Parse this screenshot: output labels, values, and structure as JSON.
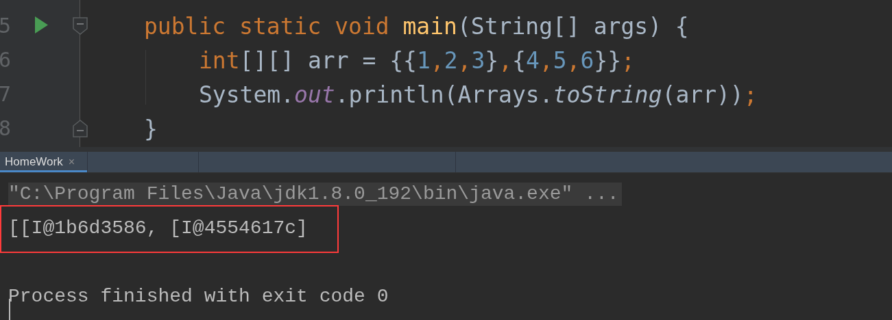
{
  "editor": {
    "lines": [
      {
        "number": "5",
        "runnable": true,
        "fold_start": true,
        "tokens": [
          {
            "text": "public static void ",
            "kind": "keyword"
          },
          {
            "text": "main",
            "kind": "method"
          },
          {
            "text": "(String[] args) {",
            "kind": "plain"
          }
        ],
        "children": [
          {
            "number": "6",
            "tokens": [
              {
                "text": "int",
                "kind": "keyword"
              },
              {
                "text": "[][] arr = {{",
                "kind": "plain"
              },
              {
                "text": "1",
                "kind": "number"
              },
              {
                "text": ",",
                "kind": "keyword"
              },
              {
                "text": "2",
                "kind": "number"
              },
              {
                "text": ",",
                "kind": "keyword"
              },
              {
                "text": "3",
                "kind": "number"
              },
              {
                "text": "}",
                "kind": "plain"
              },
              {
                "text": ",",
                "kind": "keyword"
              },
              {
                "text": "{",
                "kind": "plain"
              },
              {
                "text": "4",
                "kind": "number"
              },
              {
                "text": ",",
                "kind": "keyword"
              },
              {
                "text": "5",
                "kind": "number"
              },
              {
                "text": ",",
                "kind": "keyword"
              },
              {
                "text": "6",
                "kind": "number"
              },
              {
                "text": "}}",
                "kind": "plain"
              },
              {
                "text": ";",
                "kind": "keyword"
              }
            ]
          },
          {
            "number": "7",
            "tokens": [
              {
                "text": "System.",
                "kind": "plain"
              },
              {
                "text": "out",
                "kind": "field"
              },
              {
                "text": ".println(Arrays.",
                "kind": "plain"
              },
              {
                "text": "toString",
                "kind": "static"
              },
              {
                "text": "(arr))",
                "kind": "plain"
              },
              {
                "text": ";",
                "kind": "keyword"
              }
            ]
          }
        ]
      },
      {
        "number": "8",
        "fold_end": true,
        "tokens": [
          {
            "text": "}",
            "kind": "plain"
          }
        ]
      }
    ]
  },
  "run_tabs": [
    {
      "label": "HomeWork",
      "selected": true,
      "close": "×"
    }
  ],
  "console": {
    "lines": [
      {
        "kind": "command",
        "text": "\"C:\\Program Files\\Java\\jdk1.8.0_192\\bin\\java.exe\" ..."
      },
      {
        "kind": "output",
        "text": "[[I@1b6d3586, [I@4554617c]"
      },
      {
        "kind": "blank"
      },
      {
        "kind": "output",
        "text": "Process finished with exit code 0"
      }
    ]
  }
}
